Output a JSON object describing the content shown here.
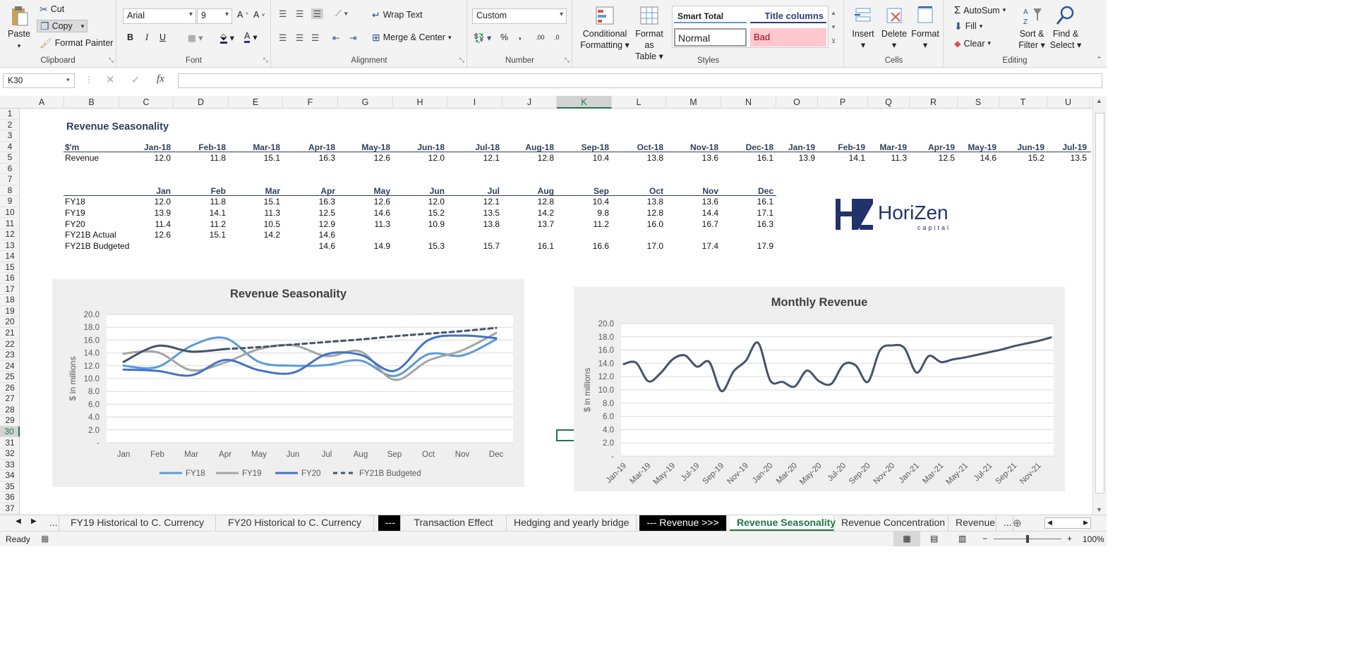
{
  "ribbon": {
    "clipboard": {
      "paste": "Paste",
      "cut": "Cut",
      "copy": "Copy",
      "format_painter": "Format Painter",
      "label": "Clipboard"
    },
    "font": {
      "name": "Arial",
      "size": "9",
      "bold": "B",
      "italic": "I",
      "underline": "U",
      "label": "Font"
    },
    "alignment": {
      "wrap_text": "Wrap Text",
      "merge_center": "Merge & Center",
      "label": "Alignment"
    },
    "number": {
      "format": "Custom",
      "percent": "%",
      "comma": ",",
      "inc_decimal": ".00",
      "dec_decimal": ".0",
      "label": "Number"
    },
    "styles": {
      "conditional": "Conditional",
      "conditional2": "Formatting",
      "format_as": "Format as",
      "format_as2": "Table",
      "smart_total": "Smart Total",
      "title_columns": "Title columns",
      "normal": "Normal",
      "bad": "Bad",
      "label": "Styles"
    },
    "cells": {
      "insert": "Insert",
      "delete": "Delete",
      "format": "Format",
      "label": "Cells"
    },
    "editing": {
      "autosum": "AutoSum",
      "fill": "Fill",
      "clear": "Clear",
      "sort": "Sort &",
      "sort2": "Filter",
      "find": "Find &",
      "find2": "Select",
      "label": "Editing"
    }
  },
  "formula_bar": {
    "name_box": "K30",
    "fx": "fx",
    "formula": ""
  },
  "columns": [
    "A",
    "B",
    "C",
    "D",
    "E",
    "F",
    "G",
    "H",
    "I",
    "J",
    "K",
    "L",
    "M",
    "N",
    "O",
    "P",
    "Q",
    "R",
    "S",
    "T",
    "U"
  ],
  "rows": [
    "1",
    "2",
    "3",
    "4",
    "5",
    "6",
    "7",
    "8",
    "9",
    "10",
    "11",
    "12",
    "13",
    "14",
    "15",
    "16",
    "17",
    "18",
    "19",
    "20",
    "21",
    "22",
    "23",
    "24",
    "25",
    "26",
    "27",
    "28",
    "29",
    "30",
    "31",
    "32",
    "33",
    "34",
    "35",
    "36",
    "37"
  ],
  "sheet": {
    "title": "Revenue Seasonality",
    "unit": "$'m",
    "months_row": [
      "Jan-18",
      "Feb-18",
      "Mar-18",
      "Apr-18",
      "May-18",
      "Jun-18",
      "Jul-18",
      "Aug-18",
      "Sep-18",
      "Oct-18",
      "Nov-18",
      "Dec-18",
      "Jan-19",
      "Feb-19",
      "Mar-19",
      "Apr-19",
      "May-19",
      "Jun-19",
      "Jul-19"
    ],
    "revenue_label": "Revenue",
    "revenue_values": [
      "12.0",
      "11.8",
      "15.1",
      "16.3",
      "12.6",
      "12.0",
      "12.1",
      "12.8",
      "10.4",
      "13.8",
      "13.6",
      "16.1",
      "13.9",
      "14.1",
      "11.3",
      "12.5",
      "14.6",
      "15.2",
      "13.5"
    ],
    "table_months": [
      "Jan",
      "Feb",
      "Mar",
      "Apr",
      "May",
      "Jun",
      "Jul",
      "Aug",
      "Sep",
      "Oct",
      "Nov",
      "Dec"
    ],
    "table_rows": [
      {
        "label": "FY18",
        "values": [
          "12.0",
          "11.8",
          "15.1",
          "16.3",
          "12.6",
          "12.0",
          "12.1",
          "12.8",
          "10.4",
          "13.8",
          "13.6",
          "16.1"
        ]
      },
      {
        "label": "FY19",
        "values": [
          "13.9",
          "14.1",
          "11.3",
          "12.5",
          "14.6",
          "15.2",
          "13.5",
          "14.2",
          "9.8",
          "12.8",
          "14.4",
          "17.1"
        ]
      },
      {
        "label": "FY20",
        "values": [
          "11.4",
          "11.2",
          "10.5",
          "12.9",
          "11.3",
          "10.9",
          "13.8",
          "13.7",
          "11.2",
          "16.0",
          "16.7",
          "16.3"
        ]
      },
      {
        "label": "FY21B Actual",
        "values": [
          "12.6",
          "15.1",
          "14.2",
          "14.6",
          "",
          "",
          "",
          "",
          "",
          "",
          "",
          ""
        ]
      },
      {
        "label": "FY21B Budgeted",
        "values": [
          "",
          "",
          "",
          "14.6",
          "14.9",
          "15.3",
          "15.7",
          "16.1",
          "16.6",
          "17.0",
          "17.4",
          "17.9"
        ]
      }
    ],
    "logo": {
      "text": "HoriZen",
      "sub": "capital",
      "mark": "HZ"
    }
  },
  "chart_data": [
    {
      "type": "line",
      "title": "Revenue Seasonality",
      "ylabel": "$ in millions",
      "ylim": [
        0,
        20
      ],
      "yticks": [
        "-",
        "2.0",
        "4.0",
        "6.0",
        "8.0",
        "10.0",
        "12.0",
        "14.0",
        "16.0",
        "18.0",
        "20.0"
      ],
      "categories": [
        "Jan",
        "Feb",
        "Mar",
        "Apr",
        "May",
        "Jun",
        "Jul",
        "Aug",
        "Sep",
        "Oct",
        "Nov",
        "Dec"
      ],
      "legend_position": "bottom",
      "series": [
        {
          "name": "FY18",
          "color": "#5b9bd5",
          "dashed": false,
          "values": [
            12.0,
            11.8,
            15.1,
            16.3,
            12.6,
            12.0,
            12.1,
            12.8,
            10.4,
            13.8,
            13.6,
            16.1
          ]
        },
        {
          "name": "FY19",
          "color": "#a5a5a5",
          "dashed": false,
          "values": [
            13.9,
            14.1,
            11.3,
            12.5,
            14.6,
            15.2,
            13.5,
            14.2,
            9.8,
            12.8,
            14.4,
            17.1
          ]
        },
        {
          "name": "FY20",
          "color": "#4472c4",
          "dashed": false,
          "values": [
            11.4,
            11.2,
            10.5,
            12.9,
            11.3,
            10.9,
            13.8,
            13.7,
            11.2,
            16.0,
            16.7,
            16.3
          ]
        },
        {
          "name": "",
          "color": "#44546a",
          "dashed": false,
          "values": [
            12.6,
            15.1,
            14.2,
            14.6,
            null,
            null,
            null,
            null,
            null,
            null,
            null,
            null
          ]
        },
        {
          "name": "FY21B Budgeted",
          "color": "#44546a",
          "dashed": true,
          "values": [
            null,
            null,
            null,
            14.6,
            14.9,
            15.3,
            15.7,
            16.1,
            16.6,
            17.0,
            17.4,
            17.9
          ]
        }
      ]
    },
    {
      "type": "line",
      "title": "Monthly Revenue",
      "ylabel": "$ in millions",
      "ylim": [
        0,
        20
      ],
      "yticks": [
        "-",
        "2.0",
        "4.0",
        "6.0",
        "8.0",
        "10.0",
        "12.0",
        "14.0",
        "16.0",
        "18.0",
        "20.0"
      ],
      "tick_labels": [
        "Jan-19",
        "Mar-19",
        "May-19",
        "Jul-19",
        "Sep-19",
        "Nov-19",
        "Jan-20",
        "Mar-20",
        "May-20",
        "Jul-20",
        "Sep-20",
        "Nov-20",
        "Jan-21",
        "Mar-21",
        "May-21",
        "Jul-21",
        "Sep-21",
        "Nov-21"
      ],
      "series": [
        {
          "color": "#44546a",
          "values": [
            13.9,
            14.1,
            11.3,
            12.5,
            14.6,
            15.2,
            13.5,
            14.2,
            9.8,
            12.8,
            14.4,
            17.1,
            11.4,
            11.2,
            10.5,
            12.9,
            11.3,
            10.9,
            13.8,
            13.7,
            11.2,
            16.0,
            16.7,
            16.3,
            12.6,
            15.1,
            14.2,
            14.6,
            14.9,
            15.3,
            15.7,
            16.1,
            16.6,
            17.0,
            17.4,
            17.9
          ]
        }
      ]
    }
  ],
  "tabs": [
    {
      "label": "...",
      "style": ""
    },
    {
      "label": "FY19 Historical to C. Currency",
      "style": ""
    },
    {
      "label": "FY20 Historical to C. Currency",
      "style": ""
    },
    {
      "label": "---",
      "style": "blk"
    },
    {
      "label": "Transaction Effect",
      "style": ""
    },
    {
      "label": "Hedging and yearly bridge",
      "style": ""
    },
    {
      "label": "--- Revenue >>>",
      "style": "blk"
    },
    {
      "label": "Revenue Seasonality",
      "style": "act"
    },
    {
      "label": "Revenue Concentration",
      "style": ""
    },
    {
      "label": "Revenue",
      "style": ""
    },
    {
      "label": "...",
      "style": ""
    }
  ],
  "status": {
    "ready": "Ready",
    "zoom": "100%"
  }
}
